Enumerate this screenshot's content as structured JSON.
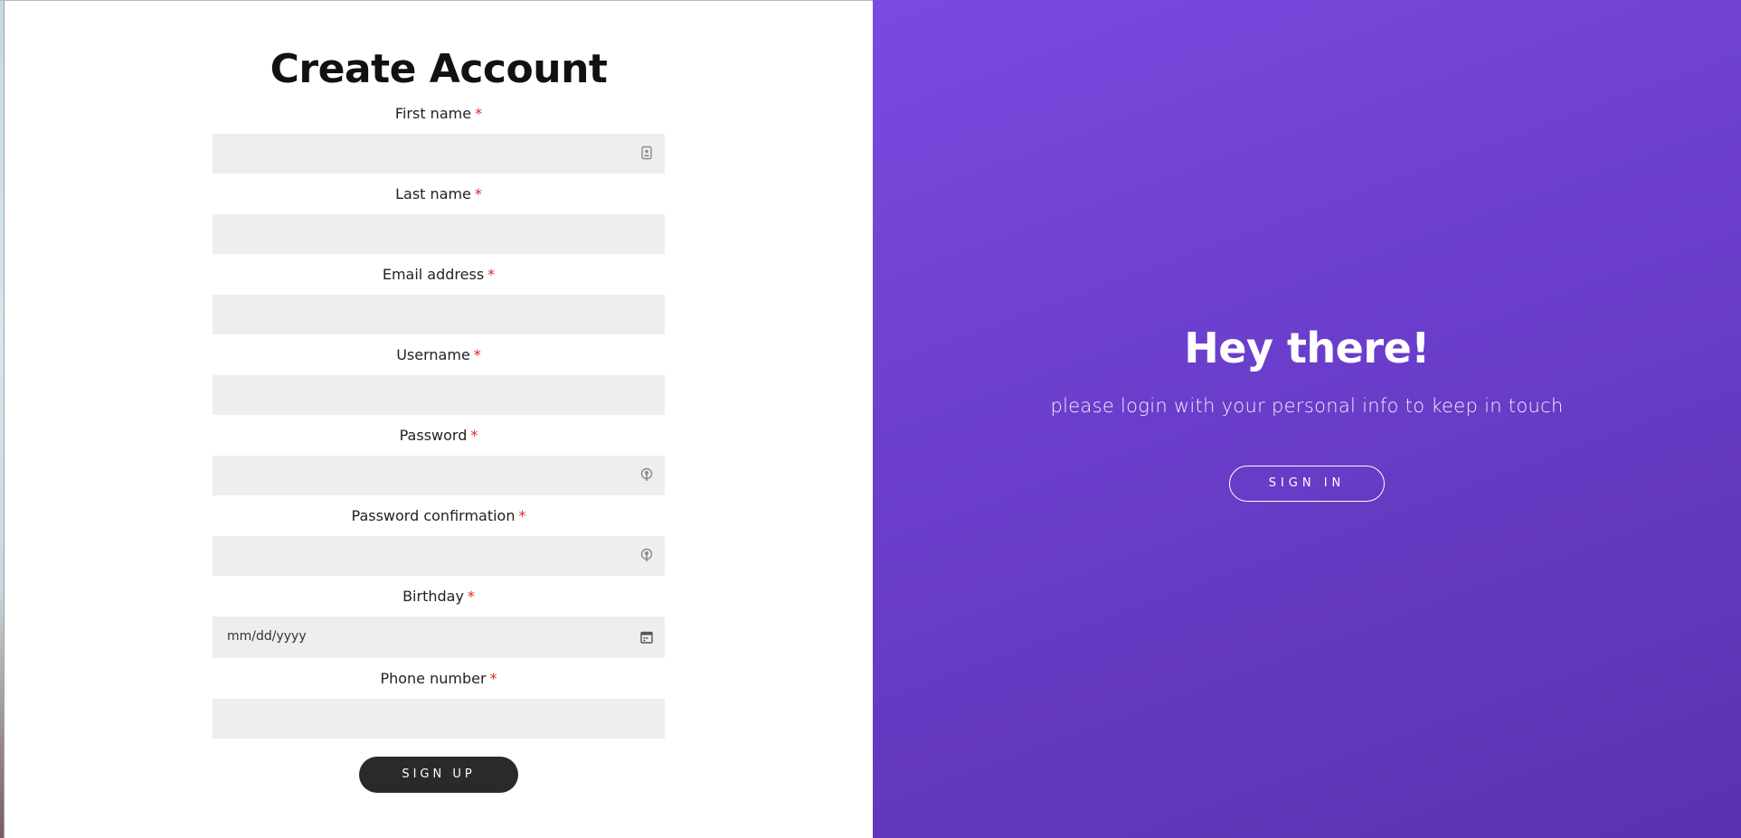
{
  "form": {
    "title": "Create Account",
    "required_marker": "*",
    "fields": [
      {
        "label": "First name",
        "value": "",
        "icon": "contact-card-icon"
      },
      {
        "label": "Last name",
        "value": "",
        "icon": ""
      },
      {
        "label": "Email address",
        "value": "",
        "icon": ""
      },
      {
        "label": "Username",
        "value": "",
        "icon": ""
      },
      {
        "label": "Password",
        "value": "",
        "icon": "key-icon"
      },
      {
        "label": "Password confirmation",
        "value": "",
        "icon": "key-icon"
      },
      {
        "label": "Birthday",
        "value": "",
        "placeholder": "mm/dd/yyyy",
        "icon": "calendar-icon"
      },
      {
        "label": "Phone number",
        "value": "",
        "icon": ""
      }
    ],
    "submit_label": "SIGN UP"
  },
  "promo": {
    "title": "Hey there!",
    "subtitle": "please login with your personal info to keep in touch",
    "signin_label": "SIGN IN"
  },
  "colors": {
    "accent_purple": "#7a4adf",
    "accent_purple_dark": "#5a32b0",
    "button_dark": "#2a2a2a",
    "input_bg": "#eeeeee",
    "required_red": "#e02424"
  }
}
